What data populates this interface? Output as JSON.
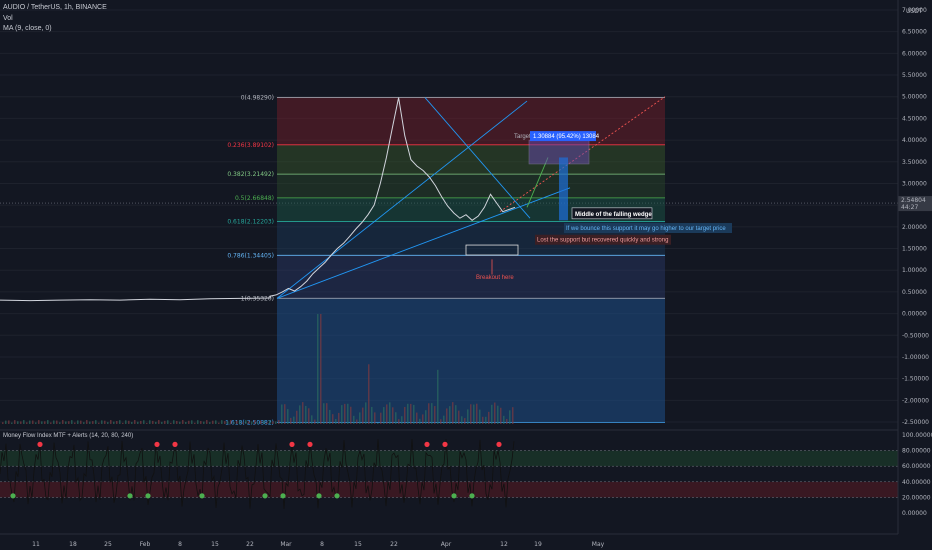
{
  "header": {
    "symbol_line": "AUDIO / TetherUS, 1h, BINANCE",
    "vol_label": "Vol",
    "ma_label": "MA (9, close, 0)"
  },
  "colors": {
    "background": "#131722",
    "price_line": "#d1d4dc",
    "trend_line": "#2196f3",
    "green_dot": "#4caf50",
    "red_dot": "#f23645",
    "target_box": "#7e57c2",
    "target_label_bg": "#2962ff"
  },
  "chart_data": [
    {
      "type": "line",
      "series": [
        {
          "values": [
            0.31,
            0.3,
            0.31,
            0.32,
            0.31,
            0.33,
            0.32,
            0.34,
            0.35,
            0.36,
            0.4,
            0.43,
            0.5,
            0.58,
            0.52,
            0.62,
            0.75,
            0.92,
            1.05,
            1.18,
            1.35,
            1.5,
            1.62,
            1.78,
            1.95,
            2.1,
            2.28,
            2.5,
            3.0,
            3.6,
            4.3,
            4.98,
            4.1,
            3.55,
            3.4,
            3.3,
            3.15,
            2.95,
            2.7,
            2.48,
            2.32,
            2.2,
            2.28,
            2.15,
            2.25,
            2.45,
            2.75,
            2.55,
            2.35,
            2.4,
            2.45
          ]
        }
      ],
      "x_ticks": [
        "11",
        "18",
        "25",
        "Feb",
        "8",
        "15",
        "22",
        "Mar",
        "8",
        "15",
        "22",
        "Apr",
        "12",
        "19",
        "May"
      ],
      "y_ticks": [
        "7.00000",
        "6.50000",
        "6.00000",
        "5.50000",
        "5.00000",
        "4.50000",
        "4.00000",
        "3.50000",
        "3.00000",
        "2.50000",
        "2.00000",
        "1.50000",
        "1.00000",
        "0.50000",
        "0.00000",
        "-0.50000",
        "-1.00000",
        "-1.50000",
        "-2.00000",
        "-2.50000"
      ],
      "y_axis_unit": "USDT",
      "ylim": [
        -2.5,
        7.0
      ],
      "current_price": "2.54804",
      "current_price_sub": "44:27",
      "fib_levels": [
        {
          "label": "0(4.98290)",
          "value": 4.9829
        },
        {
          "label": "0.236(3.89102)",
          "value": 3.89102
        },
        {
          "label": "0.382(3.21492)",
          "value": 3.21492
        },
        {
          "label": "0.5(2.66848)",
          "value": 2.66848
        },
        {
          "label": "0.618(2.12203)",
          "value": 2.12203
        },
        {
          "label": "0.786(1.34405)",
          "value": 1.34405
        },
        {
          "label": "1(0.35320)",
          "value": 0.3532
        },
        {
          "label": "1.618(-2.50882)",
          "value": -2.50882
        }
      ],
      "annotations": {
        "target": "Target",
        "target_measure": "1.30884 (95.42%) 13084",
        "middle_wedge": "Middle of the falling wedge",
        "bounce": "If we bounce this support it may go higher to our target price",
        "support": "Lost the support but recovered quickly and strong",
        "breakout": "Breakout here"
      }
    },
    {
      "type": "line",
      "title": "Money Flow Index MTF + Alerts (14, 20, 80, 240)",
      "y_ticks": [
        "100.00000",
        "80.00000",
        "60.00000",
        "40.00000",
        "20.00000",
        "0.00000"
      ],
      "ylim": [
        0,
        100
      ],
      "upper_band": 80,
      "lower_band": 20
    }
  ]
}
